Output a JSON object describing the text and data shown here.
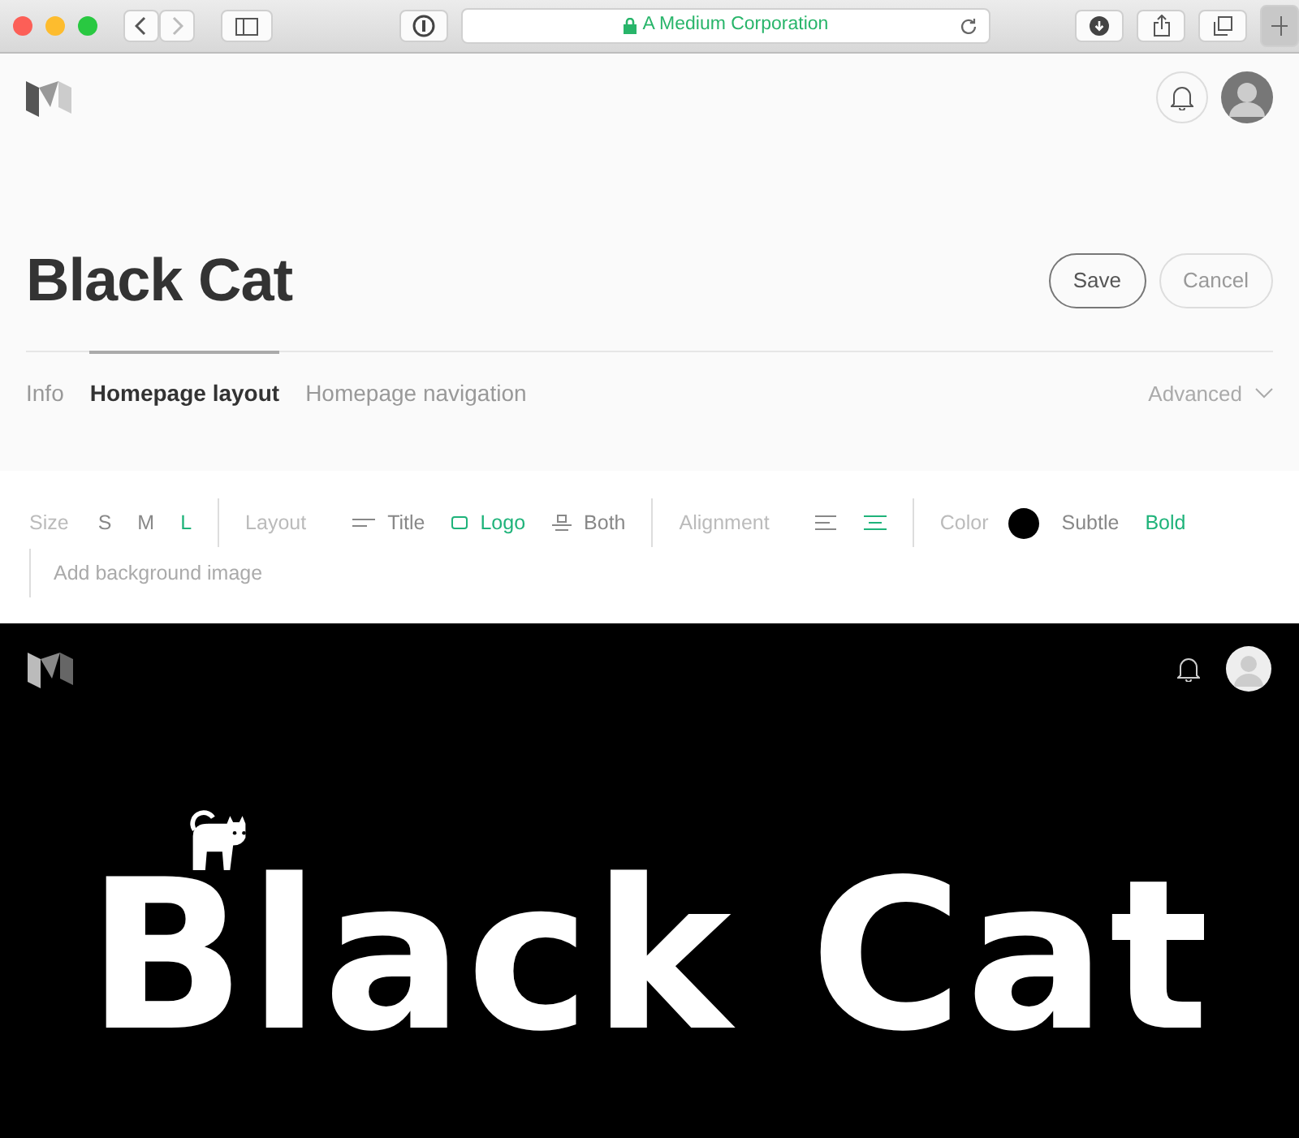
{
  "browser": {
    "address": "A Medium Corporation"
  },
  "page_title": "Black Cat",
  "actions": [
    {
      "label": "Save",
      "kind": "primary"
    },
    {
      "label": "Cancel",
      "kind": "secondary"
    }
  ],
  "tabs": [
    {
      "label": "Info",
      "selected": false
    },
    {
      "label": "Homepage layout",
      "selected": true
    },
    {
      "label": "Homepage navigation",
      "selected": false
    }
  ],
  "advanced": "Advanced",
  "toolbar": {
    "size": {
      "label": "Size",
      "options": [
        {
          "label": "S",
          "selected": false
        },
        {
          "label": "M",
          "selected": false
        },
        {
          "label": "L",
          "selected": true
        }
      ]
    },
    "layout": {
      "label": "Layout",
      "options": [
        {
          "kind": "title",
          "label": "Title",
          "selected": false
        },
        {
          "kind": "logo",
          "label": "Logo",
          "selected": true
        },
        {
          "kind": "both",
          "label": "Both",
          "selected": false
        }
      ]
    },
    "alignment": {
      "label": "Alignment",
      "options": [
        {
          "kind": "left",
          "selected": false
        },
        {
          "kind": "center",
          "selected": true
        }
      ]
    },
    "color": {
      "label": "Color",
      "color": "#000000",
      "options": [
        {
          "label": "Subtle",
          "selected": false
        },
        {
          "label": "Bold",
          "selected": true
        }
      ]
    },
    "background": "Add background image"
  },
  "preview": {
    "logo_text": "Black Cat"
  }
}
